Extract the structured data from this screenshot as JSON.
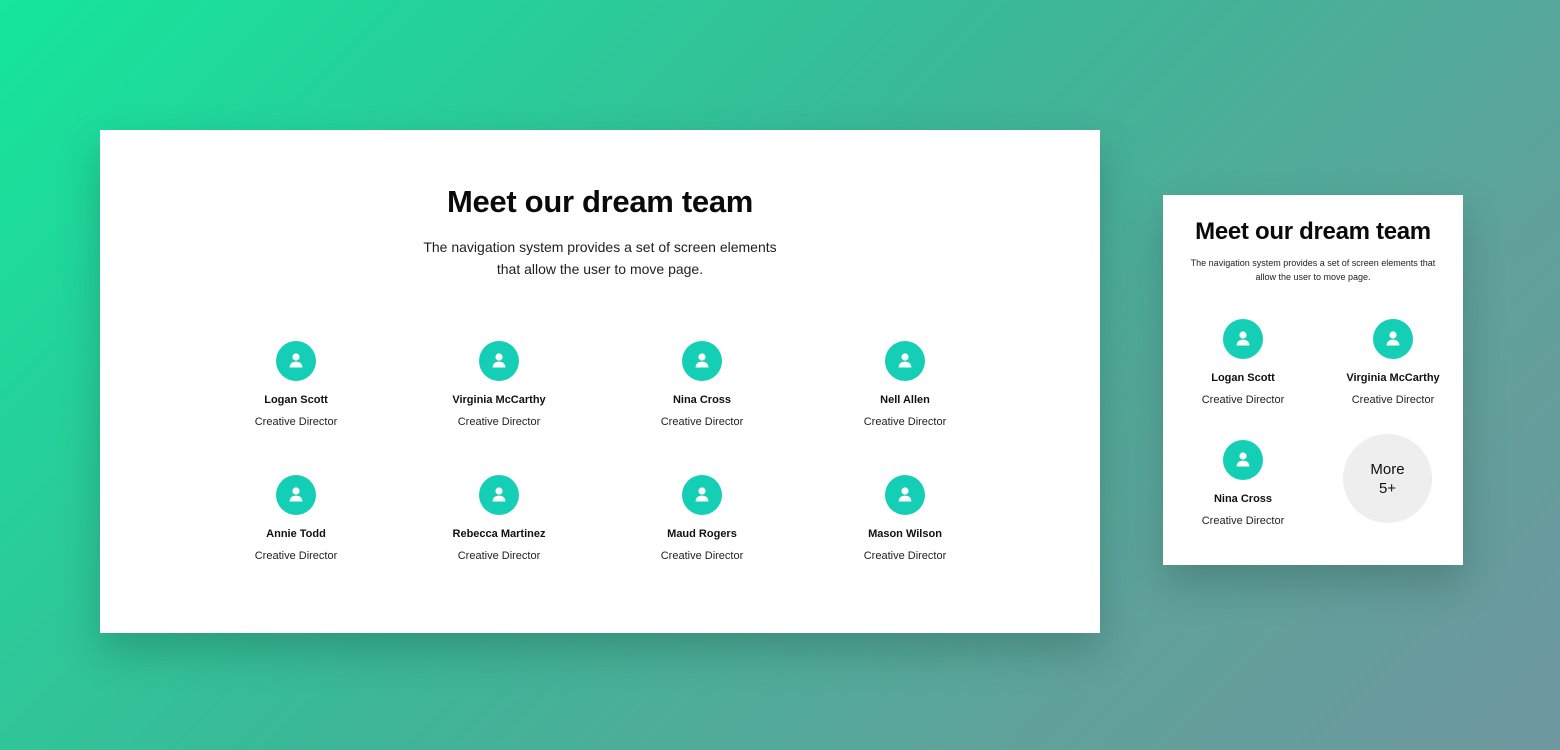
{
  "colors": {
    "avatar_bg": "#14cfb5",
    "more_bg": "#eeeeee",
    "page_gradient": [
      "#14e69c",
      "#6e979f"
    ]
  },
  "desktop": {
    "title": "Meet our dream team",
    "subtitle": "The navigation system provides a set of screen elements that allow the user to move page.",
    "members": [
      {
        "name": "Logan Scott",
        "role": "Creative Director",
        "icon": "user-icon"
      },
      {
        "name": "Virginia McCarthy",
        "role": "Creative Director",
        "icon": "user-icon"
      },
      {
        "name": "Nina Cross",
        "role": "Creative Director",
        "icon": "user-icon"
      },
      {
        "name": "Nell Allen",
        "role": "Creative Director",
        "icon": "user-icon"
      },
      {
        "name": "Annie Todd",
        "role": "Creative Director",
        "icon": "user-icon"
      },
      {
        "name": "Rebecca Martinez",
        "role": "Creative Director",
        "icon": "user-icon"
      },
      {
        "name": "Maud Rogers",
        "role": "Creative Director",
        "icon": "user-icon"
      },
      {
        "name": "Mason Wilson",
        "role": "Creative Director",
        "icon": "user-icon"
      }
    ]
  },
  "mobile": {
    "title": "Meet our dream team",
    "subtitle": "The navigation system provides a set of screen elements that allow the user to move page.",
    "members": [
      {
        "name": "Logan Scott",
        "role": "Creative Director",
        "icon": "user-icon"
      },
      {
        "name": "Virginia McCarthy",
        "role": "Creative Director",
        "icon": "user-icon"
      },
      {
        "name": "Nina Cross",
        "role": "Creative Director",
        "icon": "user-icon"
      }
    ],
    "more": {
      "label": "More",
      "count": "5+"
    }
  }
}
